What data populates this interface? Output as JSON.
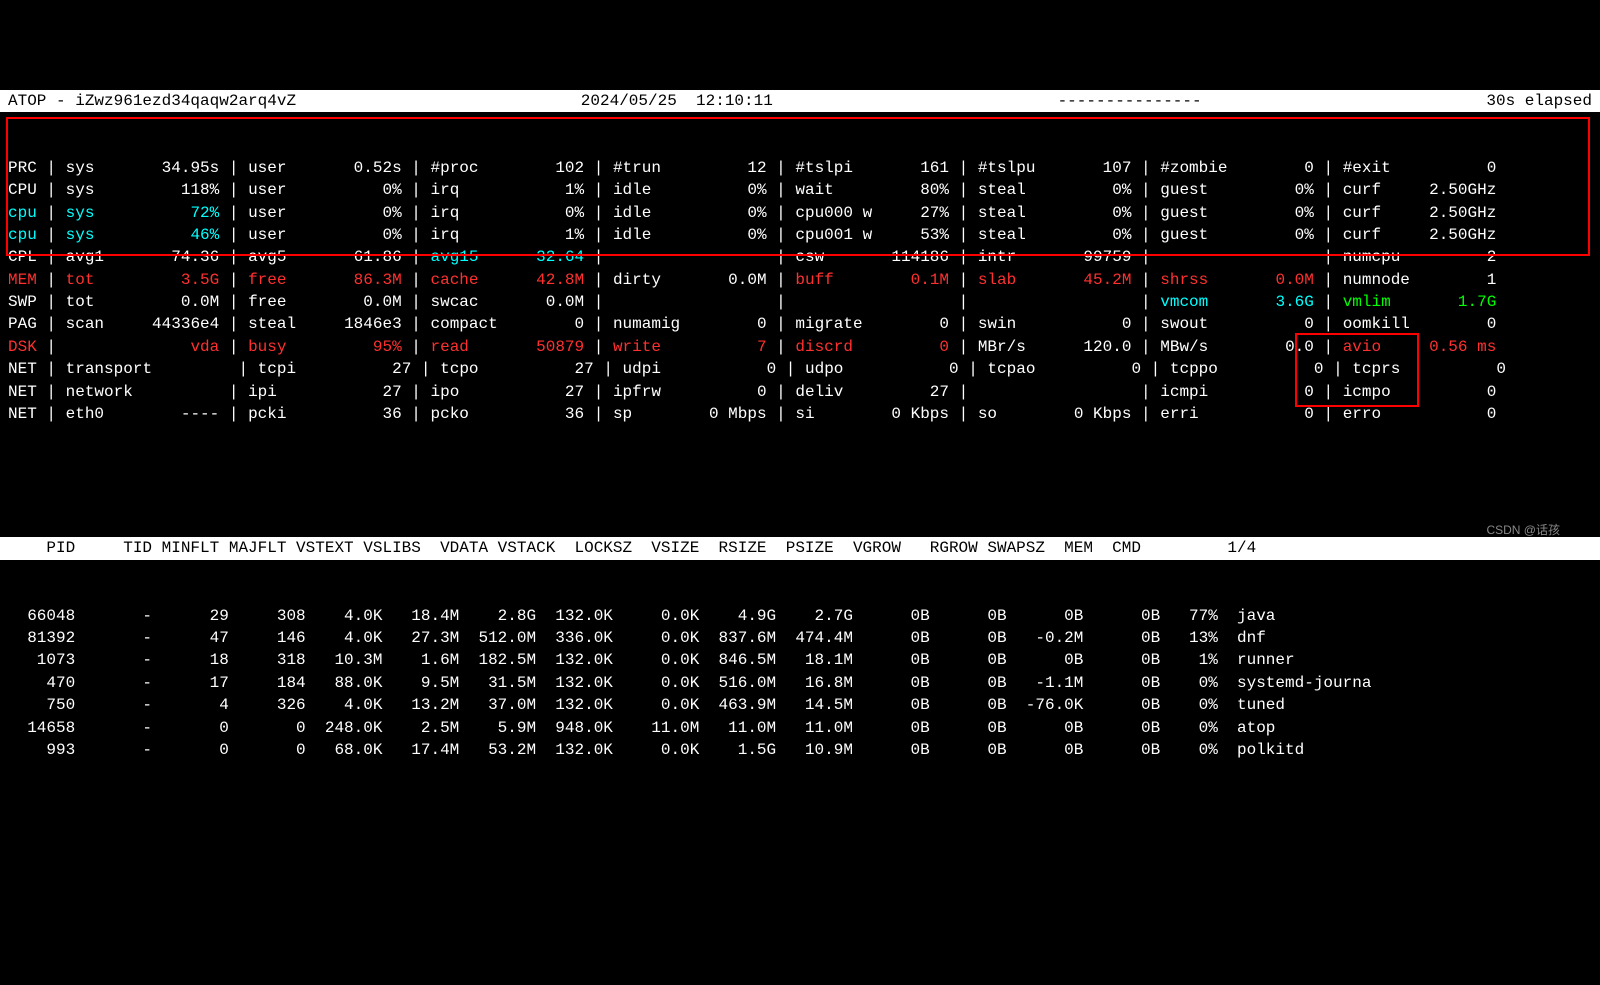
{
  "header": {
    "title": "ATOP - iZwz961ezd34qaqw2arq4vZ",
    "datetime": "2024/05/25  12:10:11",
    "dashes": "---------------",
    "elapsed": "30s elapsed"
  },
  "sys": [
    {
      "label": "PRC",
      "cells": [
        [
          "sys",
          "34.95s"
        ],
        [
          "user",
          "0.52s"
        ],
        [
          "#proc",
          "102"
        ],
        [
          "#trun",
          "12"
        ],
        [
          "#tslpi",
          "161"
        ],
        [
          "#tslpu",
          "107"
        ],
        [
          "#zombie",
          "0"
        ],
        [
          "#exit",
          "0"
        ]
      ]
    },
    {
      "label": "CPU",
      "cells": [
        [
          "sys",
          "118%"
        ],
        [
          "user",
          "0%"
        ],
        [
          "irq",
          "1%"
        ],
        [
          "idle",
          "0%"
        ],
        [
          "wait",
          "80%"
        ],
        [
          "steal",
          "0%"
        ],
        [
          "guest",
          "0%"
        ],
        [
          "curf",
          "2.50GHz"
        ]
      ]
    },
    {
      "label": "cpu",
      "cells": [
        [
          "sys",
          "72%"
        ],
        [
          "user",
          "0%"
        ],
        [
          "irq",
          "0%"
        ],
        [
          "idle",
          "0%"
        ],
        [
          "cpu000 w",
          "27%"
        ],
        [
          "steal",
          "0%"
        ],
        [
          "guest",
          "0%"
        ],
        [
          "curf",
          "2.50GHz"
        ]
      ],
      "labelClass": "cyan",
      "firstClass": "cyan"
    },
    {
      "label": "cpu",
      "cells": [
        [
          "sys",
          "46%"
        ],
        [
          "user",
          "0%"
        ],
        [
          "irq",
          "1%"
        ],
        [
          "idle",
          "0%"
        ],
        [
          "cpu001 w",
          "53%"
        ],
        [
          "steal",
          "0%"
        ],
        [
          "guest",
          "0%"
        ],
        [
          "curf",
          "2.50GHz"
        ]
      ],
      "labelClass": "cyan",
      "firstClass": "cyan"
    },
    {
      "label": "CPL",
      "cells": [
        [
          "avg1",
          "74.36"
        ],
        [
          "avg5",
          "61.86"
        ],
        [
          "avg15",
          "32.64",
          "cyan"
        ],
        [
          "",
          ""
        ],
        [
          "csw",
          "114186"
        ],
        [
          "intr",
          "99759"
        ],
        [
          "",
          ""
        ],
        [
          "numcpu",
          "2"
        ]
      ]
    },
    {
      "label": "MEM",
      "cells": [
        [
          "tot",
          "3.5G",
          "red"
        ],
        [
          "free",
          "86.3M",
          "red"
        ],
        [
          "cache",
          "42.8M",
          "red"
        ],
        [
          "dirty",
          "0.0M"
        ],
        [
          "buff",
          "0.1M",
          "red"
        ],
        [
          "slab",
          "45.2M",
          "red"
        ],
        [
          "shrss",
          "0.0M",
          "red"
        ],
        [
          "numnode",
          "1"
        ]
      ],
      "labelClass": "red"
    },
    {
      "label": "SWP",
      "cells": [
        [
          "tot",
          "0.0M"
        ],
        [
          "free",
          "0.0M"
        ],
        [
          "swcac",
          "0.0M"
        ],
        [
          "",
          ""
        ],
        [
          "",
          ""
        ],
        [
          "",
          ""
        ],
        [
          "vmcom",
          "3.6G",
          "cyan"
        ],
        [
          "vmlim",
          "1.7G",
          "green"
        ]
      ]
    },
    {
      "label": "PAG",
      "cells": [
        [
          "scan",
          "44336e4"
        ],
        [
          "steal",
          "1846e3"
        ],
        [
          "compact",
          "0"
        ],
        [
          "numamig",
          "0"
        ],
        [
          "migrate",
          "0"
        ],
        [
          "swin",
          "0"
        ],
        [
          "swout",
          "0"
        ],
        [
          "oomkill",
          "0"
        ]
      ]
    },
    {
      "label": "DSK",
      "cells": [
        [
          "",
          "vda",
          "red"
        ],
        [
          "busy",
          "95%",
          "red"
        ],
        [
          "read",
          "50879",
          "red"
        ],
        [
          "write",
          "7",
          "red"
        ],
        [
          "discrd",
          "0",
          "red"
        ],
        [
          "MBr/s",
          "120.0"
        ],
        [
          "MBw/s",
          "0.0"
        ],
        [
          "avio",
          "0.56 ms",
          "red"
        ]
      ],
      "labelClass": "red"
    },
    {
      "label": "NET",
      "cells": [
        [
          "transport",
          ""
        ],
        [
          "tcpi",
          "27"
        ],
        [
          "tcpo",
          "27"
        ],
        [
          "udpi",
          "0"
        ],
        [
          "udpo",
          "0"
        ],
        [
          "tcpao",
          "0"
        ],
        [
          "tcppo",
          "0"
        ],
        [
          "tcprs",
          "0"
        ]
      ]
    },
    {
      "label": "NET",
      "cells": [
        [
          "network",
          ""
        ],
        [
          "ipi",
          "27"
        ],
        [
          "ipo",
          "27"
        ],
        [
          "ipfrw",
          "0"
        ],
        [
          "deliv",
          "27"
        ],
        [
          "",
          ""
        ],
        [
          "icmpi",
          "0"
        ],
        [
          "icmpo",
          "0"
        ]
      ]
    },
    {
      "label": "NET",
      "cells": [
        [
          "eth0",
          "----"
        ],
        [
          "pcki",
          "36"
        ],
        [
          "pcko",
          "36"
        ],
        [
          "sp",
          "0 Mbps"
        ],
        [
          "si",
          "0 Kbps"
        ],
        [
          "so",
          "0 Kbps"
        ],
        [
          "erri",
          "0"
        ],
        [
          "erro",
          "0"
        ]
      ]
    }
  ],
  "colheader": "    PID     TID MINFLT MAJFLT VSTEXT VSLIBS  VDATA VSTACK  LOCKSZ  VSIZE  RSIZE  PSIZE  VGROW   RGROW SWAPSZ  MEM  CMD         1/4",
  "procs": [
    {
      "pid": "66048",
      "tid": "-",
      "minflt": "29",
      "majflt": "308",
      "vstext": "4.0K",
      "vslibs": "18.4M",
      "vdata": "2.8G",
      "vstack": "132.0K",
      "locksz": "0.0K",
      "vsize": "4.9G",
      "rsize": "2.7G",
      "psize": "0B",
      "vgrow": "0B",
      "rgrow": "0B",
      "swapsz": "0B",
      "mem": "77%",
      "cmd": "java"
    },
    {
      "pid": "81392",
      "tid": "-",
      "minflt": "47",
      "majflt": "146",
      "vstext": "4.0K",
      "vslibs": "27.3M",
      "vdata": "512.0M",
      "vstack": "336.0K",
      "locksz": "0.0K",
      "vsize": "837.6M",
      "rsize": "474.4M",
      "psize": "0B",
      "vgrow": "0B",
      "rgrow": "-0.2M",
      "swapsz": "0B",
      "mem": "13%",
      "cmd": "dnf"
    },
    {
      "pid": "1073",
      "tid": "-",
      "minflt": "18",
      "majflt": "318",
      "vstext": "10.3M",
      "vslibs": "1.6M",
      "vdata": "182.5M",
      "vstack": "132.0K",
      "locksz": "0.0K",
      "vsize": "846.5M",
      "rsize": "18.1M",
      "psize": "0B",
      "vgrow": "0B",
      "rgrow": "0B",
      "swapsz": "0B",
      "mem": "1%",
      "cmd": "runner"
    },
    {
      "pid": "470",
      "tid": "-",
      "minflt": "17",
      "majflt": "184",
      "vstext": "88.0K",
      "vslibs": "9.5M",
      "vdata": "31.5M",
      "vstack": "132.0K",
      "locksz": "0.0K",
      "vsize": "516.0M",
      "rsize": "16.8M",
      "psize": "0B",
      "vgrow": "0B",
      "rgrow": "-1.1M",
      "swapsz": "0B",
      "mem": "0%",
      "cmd": "systemd-journa"
    },
    {
      "pid": "750",
      "tid": "-",
      "minflt": "4",
      "majflt": "326",
      "vstext": "4.0K",
      "vslibs": "13.2M",
      "vdata": "37.0M",
      "vstack": "132.0K",
      "locksz": "0.0K",
      "vsize": "463.9M",
      "rsize": "14.5M",
      "psize": "0B",
      "vgrow": "0B",
      "rgrow": "-76.0K",
      "swapsz": "0B",
      "mem": "0%",
      "cmd": "tuned"
    },
    {
      "pid": "14658",
      "tid": "-",
      "minflt": "0",
      "majflt": "0",
      "vstext": "248.0K",
      "vslibs": "2.5M",
      "vdata": "5.9M",
      "vstack": "948.0K",
      "locksz": "11.0M",
      "vsize": "11.0M",
      "rsize": "11.0M",
      "psize": "0B",
      "vgrow": "0B",
      "rgrow": "0B",
      "swapsz": "0B",
      "mem": "0%",
      "cmd": "atop"
    },
    {
      "pid": "993",
      "tid": "-",
      "minflt": "0",
      "majflt": "0",
      "vstext": "68.0K",
      "vslibs": "17.4M",
      "vdata": "53.2M",
      "vstack": "132.0K",
      "locksz": "0.0K",
      "vsize": "1.5G",
      "rsize": "10.9M",
      "psize": "0B",
      "vgrow": "0B",
      "rgrow": "0B",
      "swapsz": "0B",
      "mem": "0%",
      "cmd": "polkitd"
    }
  ],
  "watermark": "CSDN @话孩"
}
